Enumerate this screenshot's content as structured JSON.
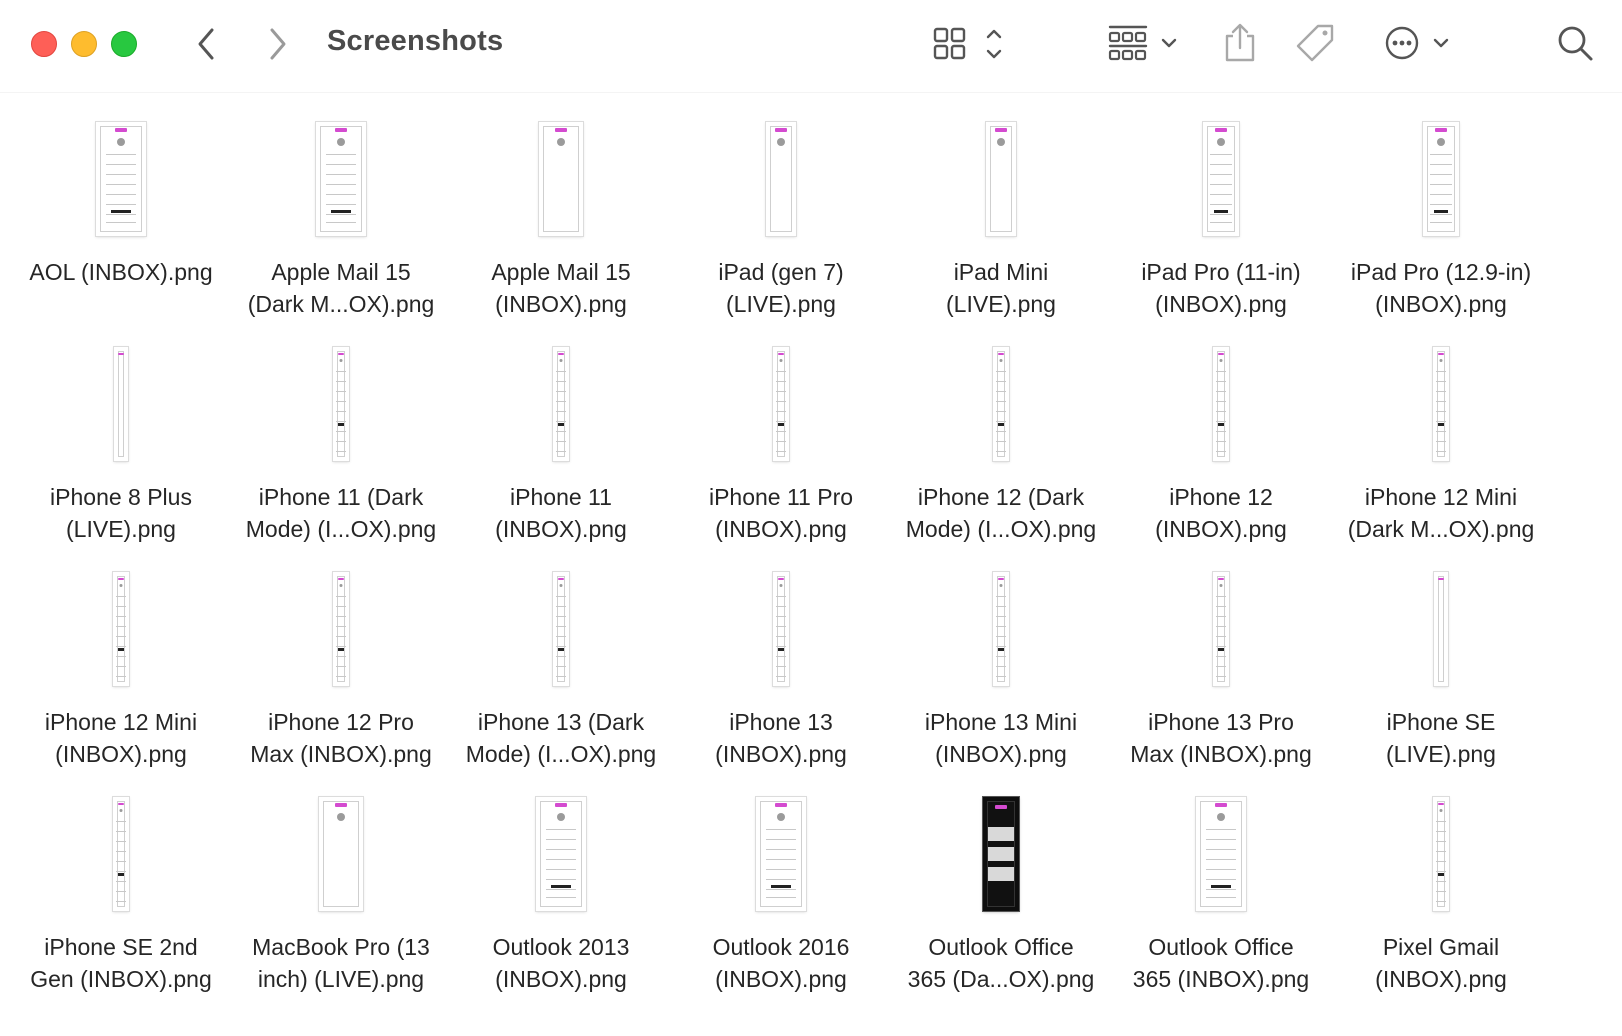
{
  "window": {
    "title": "Screenshots"
  },
  "toolbar": {
    "back_icon": "chevron-left-icon",
    "forward_icon": "chevron-right-icon",
    "view_icon": "icon-grid-view-icon",
    "group_icon": "group-by-icon",
    "share_icon": "share-icon",
    "tag_icon": "tag-icon",
    "more_icon": "ellipsis-circle-icon",
    "search_icon": "search-icon"
  },
  "files": [
    {
      "line1": "AOL (INBOX).png",
      "line2": "",
      "thumb": "wide"
    },
    {
      "line1": "Apple Mail 15",
      "line2": "(Dark M...OX).png",
      "thumb": "wide"
    },
    {
      "line1": "Apple Mail 15",
      "line2": "(INBOX).png",
      "thumb": "wide-plain"
    },
    {
      "line1": "iPad (gen 7)",
      "line2": "(LIVE).png",
      "thumb": "narrow-plain"
    },
    {
      "line1": "iPad Mini",
      "line2": "(LIVE).png",
      "thumb": "narrow-plain"
    },
    {
      "line1": "iPad Pro (11-in)",
      "line2": "(INBOX).png",
      "thumb": "narrow"
    },
    {
      "line1": "iPad Pro (12.9-in)",
      "line2": "(INBOX).png",
      "thumb": "narrow"
    },
    {
      "line1": "iPhone 8 Plus",
      "line2": "(LIVE).png",
      "thumb": "slim-plain"
    },
    {
      "line1": "iPhone 11 (Dark",
      "line2": "Mode) (I...OX).png",
      "thumb": "slim"
    },
    {
      "line1": "iPhone 11",
      "line2": "(INBOX).png",
      "thumb": "slim"
    },
    {
      "line1": "iPhone 11 Pro",
      "line2": "(INBOX).png",
      "thumb": "slim"
    },
    {
      "line1": "iPhone 12 (Dark",
      "line2": "Mode) (I...OX).png",
      "thumb": "slim"
    },
    {
      "line1": "iPhone 12",
      "line2": "(INBOX).png",
      "thumb": "slim"
    },
    {
      "line1": "iPhone 12 Mini",
      "line2": "(Dark M...OX).png",
      "thumb": "slim"
    },
    {
      "line1": "iPhone 12 Mini",
      "line2": "(INBOX).png",
      "thumb": "slim"
    },
    {
      "line1": "iPhone 12 Pro",
      "line2": "Max (INBOX).png",
      "thumb": "slim"
    },
    {
      "line1": "iPhone 13 (Dark",
      "line2": "Mode) (I...OX).png",
      "thumb": "slim"
    },
    {
      "line1": "iPhone 13",
      "line2": "(INBOX).png",
      "thumb": "slim"
    },
    {
      "line1": "iPhone 13 Mini",
      "line2": "(INBOX).png",
      "thumb": "slim"
    },
    {
      "line1": "iPhone 13 Pro",
      "line2": "Max (INBOX).png",
      "thumb": "slim"
    },
    {
      "line1": "iPhone SE",
      "line2": "(LIVE).png",
      "thumb": "slim-plain"
    },
    {
      "line1": "iPhone SE 2nd",
      "line2": "Gen (INBOX).png",
      "thumb": "slim"
    },
    {
      "line1": "MacBook Pro (13",
      "line2": "inch) (LIVE).png",
      "thumb": "wide-plain"
    },
    {
      "line1": "Outlook 2013",
      "line2": "(INBOX).png",
      "thumb": "wide"
    },
    {
      "line1": "Outlook 2016",
      "line2": "(INBOX).png",
      "thumb": "wide"
    },
    {
      "line1": "Outlook Office",
      "line2": "365 (Da...OX).png",
      "thumb": "dark"
    },
    {
      "line1": "Outlook Office",
      "line2": "365 (INBOX).png",
      "thumb": "wide"
    },
    {
      "line1": "Pixel Gmail",
      "line2": "(INBOX).png",
      "thumb": "slim"
    }
  ]
}
